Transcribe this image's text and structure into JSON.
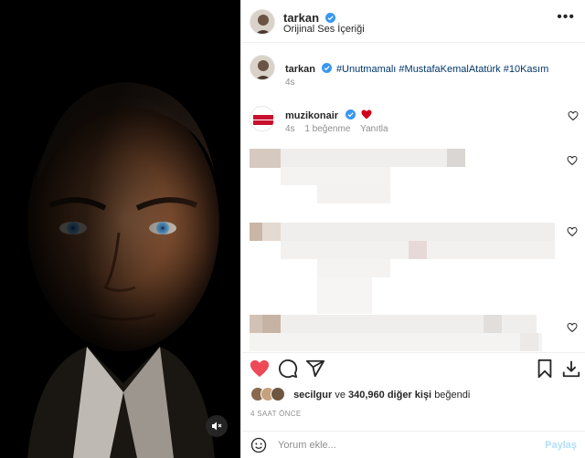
{
  "post": {
    "author": "tarkan",
    "audio": "Orijinal Ses İçeriği",
    "caption_user": "tarkan",
    "caption_text": "#Unutmamalı #MustafaKemalAtatürk #10Kasım",
    "caption_time": "4s"
  },
  "comments": [
    {
      "user": "muzikonair",
      "avatar_text": "MÜZİK ONAIR",
      "time": "4s",
      "likes": "1 beğenme",
      "reply": "Yanıtla"
    }
  ],
  "likes": {
    "first_user": "secilgur",
    "connector": "ve",
    "count": "340,960 diğer kişi",
    "suffix": "beğendi"
  },
  "time_ago": "4 SAAT ÖNCE",
  "comment_box": {
    "placeholder": "Yorum ekle...",
    "post_label": "Paylaş"
  },
  "colors": {
    "heart": "#ed4956",
    "verified": "#3897f0",
    "link": "#00376b",
    "muted": "#8e8e8e"
  },
  "icons": [
    "more-icon",
    "verified-icon",
    "heart-icon",
    "comment-icon",
    "share-icon",
    "save-icon",
    "download-icon",
    "emoji-icon",
    "mute-icon"
  ]
}
